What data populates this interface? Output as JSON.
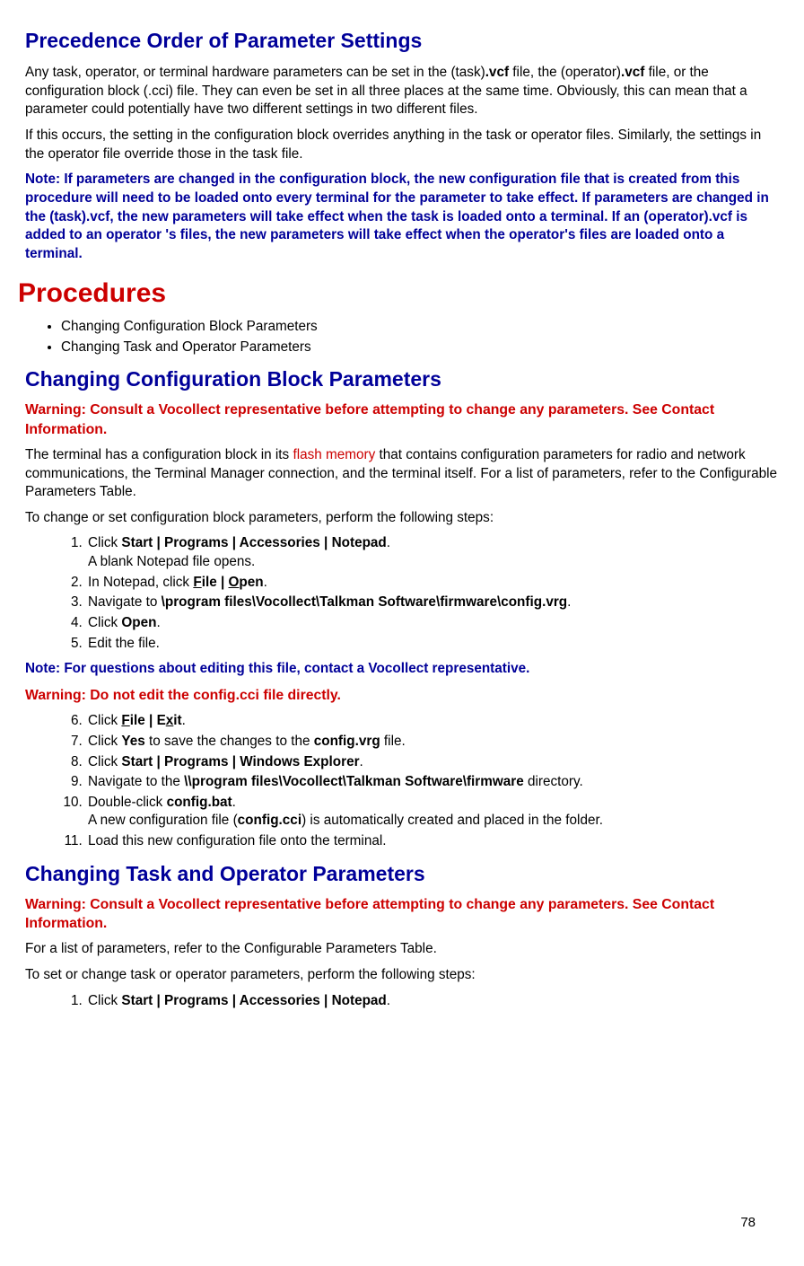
{
  "h_precedence": "Precedence Order of Parameter Settings",
  "p1a": "Any task, operator, or terminal hardware parameters can be set in the (task)",
  "p1b": ".vcf",
  "p1c": " file, the (operator)",
  "p1d": ".vcf",
  "p1e": " file, or the configuration block (.cci) file. They can even be set in all three places at the same time. Obviously, this can mean that a parameter could potentially have two different settings in two different files.",
  "p2": "If this occurs, the setting in the configuration block overrides anything in the task or operator files. Similarly, the settings in the operator file override those in the task file.",
  "note1": "Note: If parameters are changed in the configuration block, the new configuration file that is created from this procedure will need to be loaded onto every terminal for the parameter to take effect. If parameters are changed in the (task).vcf, the new parameters will take effect when the task is loaded onto a terminal. If an (operator).vcf is added to an operator 's files, the new parameters will take effect when the operator's files are loaded onto a terminal.",
  "h_procedures": "Procedures",
  "bul1": "Changing Configuration Block Parameters",
  "bul2": "Changing Task and Operator Parameters",
  "h_ccbp": "Changing Configuration Block Parameters",
  "warn1": "Warning: Consult a Vocollect representative before attempting to change any parameters. See Contact Information.",
  "p3a": "The terminal has a configuration block in its ",
  "p3_flash": "flash memory",
  "p3b": " that contains configuration parameters for radio and network communications, the Terminal Manager connection, and the terminal itself. For a list of parameters, refer to the Configurable Parameters Table.",
  "p4": "To change or set configuration block parameters, perform the following steps:",
  "s1a": "Click ",
  "s1b": "Start | Programs | Accessories | Notepad",
  "s1c": ". ",
  "s1d": " A blank Notepad file opens.",
  "s2a": "In Notepad, click ",
  "s2F": "F",
  "s2ile": "ile",
  "s2pipe": " | ",
  "s2O": "O",
  "s2pen": "pen",
  "s2dot": ".",
  "s3a": "Navigate to ",
  "s3b": "\\program files\\Vocollect\\Talkman Software\\firmware\\config.vrg",
  "s3c": ".",
  "s4a": "Click ",
  "s4b": "Open",
  "s4c": ".",
  "s5": "Edit the file.",
  "note2": "Note: For questions about editing this file, contact a Vocollect representative.",
  "warn2": "Warning: Do not edit the config.cci file directly.",
  "s6a": "Click ",
  "s6F": "F",
  "s6ile": "ile",
  "s6pipe": " | ",
  "s6Ex": "E",
  "s6x": "x",
  "s6it": "it",
  "s6dot": ".",
  "s7a": "Click ",
  "s7Yes": "Yes",
  "s7b": " to save the changes to the ",
  "s7conf": "config.vrg",
  "s7c": " file.",
  "s8a": "Click ",
  "s8b": "Start | Programs | Windows Explorer",
  "s8c": ".",
  "s9a": "Navigate to the ",
  "s9b": "\\\\program files\\Vocollect\\Talkman Software\\firmware",
  "s9c": " directory.",
  "s10a": "Double-click ",
  "s10b": "config.bat",
  "s10c": ". ",
  "s10d": " A new configuration file (",
  "s10e": "config.cci",
  "s10f": ") is automatically created and placed in the folder.",
  "s11": "Load this new configuration file onto the terminal.",
  "h_ctop": "Changing Task and Operator Parameters",
  "warn3": "Warning: Consult a Vocollect representative before attempting to change any parameters. See Contact Information.",
  "p5": "For a list of parameters, refer to the Configurable Parameters Table.",
  "p6": "To set or change task or operator parameters, perform the following steps:",
  "t1a": "Click ",
  "t1b": "Start | Programs | Accessories | Notepad",
  "t1c": ".",
  "pagenum": "78"
}
